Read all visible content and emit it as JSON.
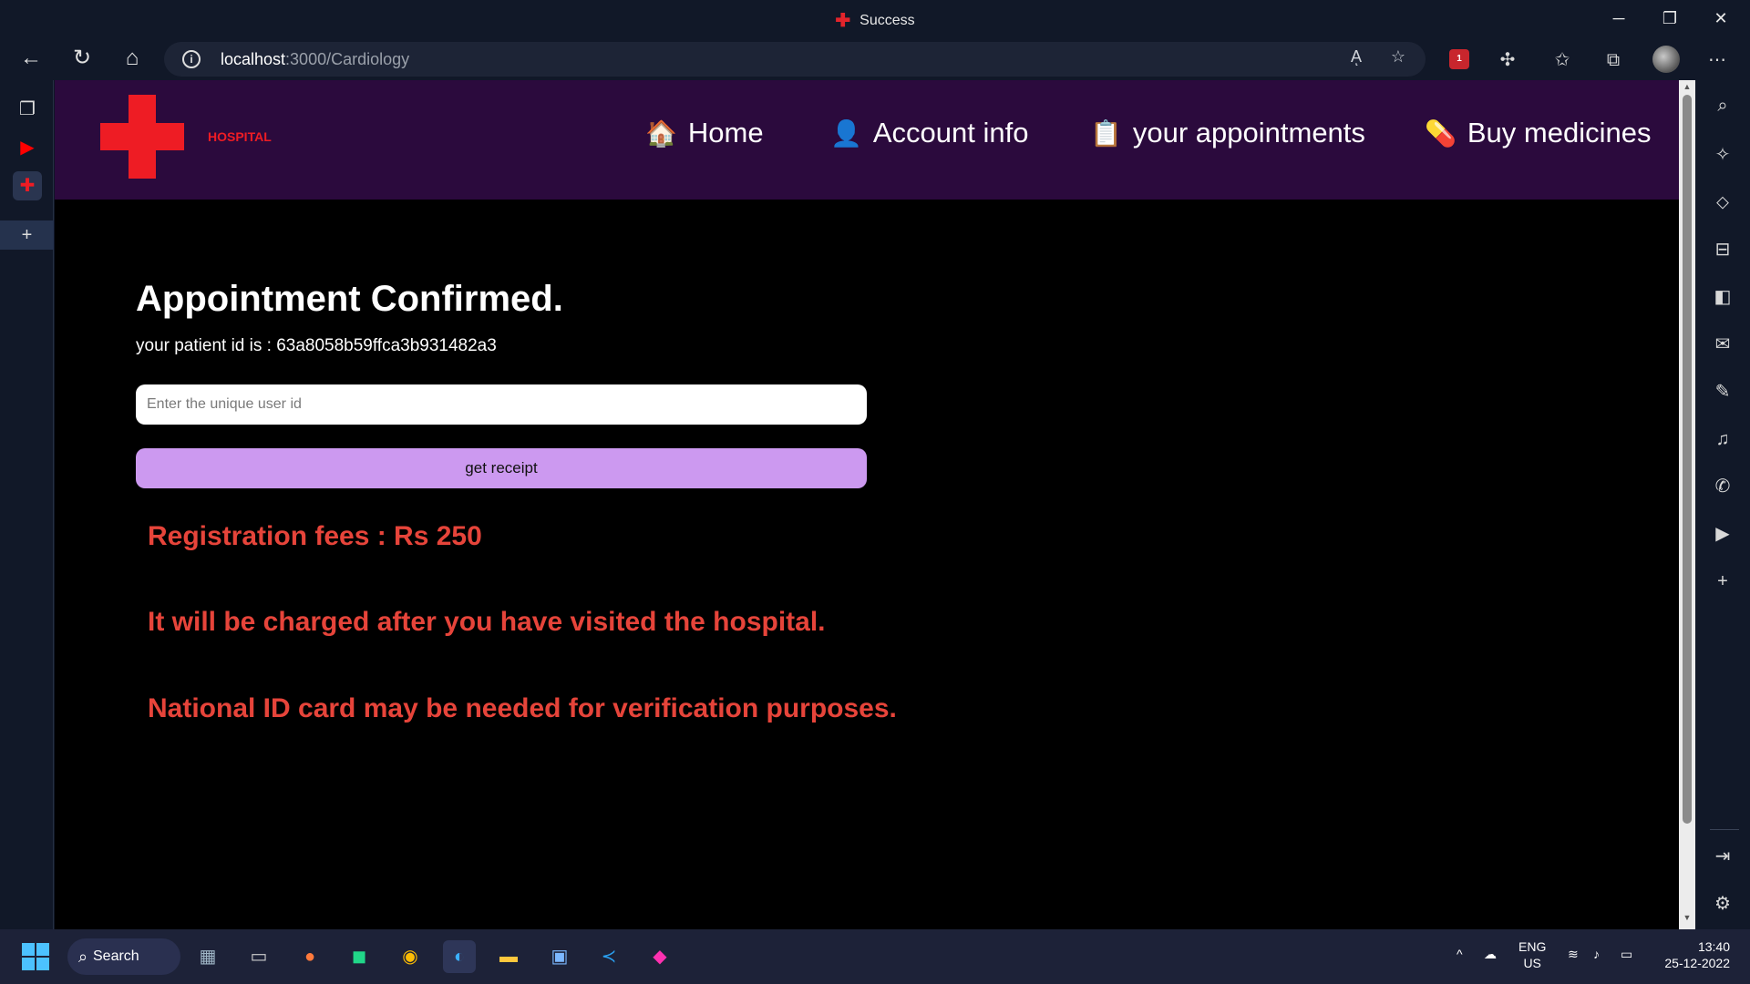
{
  "window": {
    "title": "Success",
    "minimize_icon": "─",
    "restore_icon": "❐",
    "close_icon": "✕"
  },
  "browser": {
    "url_host": "localhost",
    "url_path": ":3000/Cardiology",
    "read_aloud_icon": "Aͅ",
    "favorite_icon": "☆",
    "extension_badge": "1"
  },
  "navbar": {
    "logo_text": "HOSPITAL",
    "items": [
      {
        "icon": "🏠",
        "label": "Home"
      },
      {
        "icon": "👤",
        "label": "Account info"
      },
      {
        "icon": "📋",
        "label": "your appointments"
      },
      {
        "icon": "💊",
        "label": "Buy medicines"
      }
    ]
  },
  "main": {
    "heading": "Appointment Confirmed.",
    "patient_id_text": "your patient id is : 63a8058b59ffca3b931482a3",
    "uid_placeholder": "Enter the unique user id",
    "receipt_button": "get receipt",
    "notes": [
      "Registration fees : Rs 250",
      "It will be charged after you have visited the hospital.",
      "National ID card may be needed for verification purposes."
    ]
  },
  "taskbar": {
    "search_label": "Search",
    "language_line1": "ENG",
    "language_line2": "US",
    "time": "13:40",
    "date": "25-12-2022"
  },
  "colors": {
    "navbar_bg": "#2b0a3d",
    "logo_red": "#ee1c24",
    "note_red": "#e6443a",
    "button_purple": "#cc99f0"
  }
}
